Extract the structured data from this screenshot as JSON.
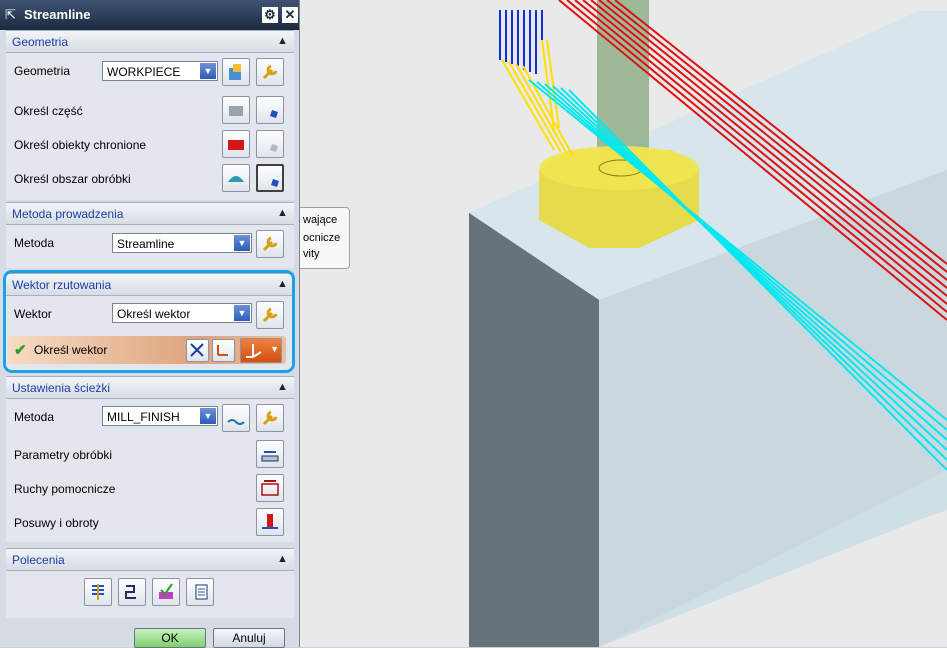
{
  "dialog": {
    "title": "Streamline",
    "settings_icon": "gear-icon",
    "close_icon": "close-icon"
  },
  "geometry": {
    "header": "Geometria",
    "geometry_label": "Geometria",
    "geometry_value": "WORKPIECE",
    "part_label": "Określ część",
    "protected_label": "Określ obiekty chronione",
    "machining_area_label": "Określ obszar obróbki"
  },
  "drive_method": {
    "header": "Metoda prowadzenia",
    "method_label": "Metoda",
    "method_value": "Streamline"
  },
  "projection_vector": {
    "header": "Wektor rzutowania",
    "vector_label": "Wektor",
    "vector_value": "Określ wektor",
    "specify_label": "Określ wektor"
  },
  "path_settings": {
    "header": "Ustawienia ścieżki",
    "method_label": "Metoda",
    "method_value": "MILL_FINISH",
    "cutting_params_label": "Parametry obróbki",
    "non_cutting_label": "Ruchy pomocnicze",
    "feeds_speeds_label": "Posuwy i obroty"
  },
  "commands": {
    "header": "Polecenia"
  },
  "buttons": {
    "ok": "OK",
    "cancel": "Anuluj"
  },
  "tooltip": {
    "line1": "wające",
    "line2": "ocnicze",
    "line3": "vity"
  },
  "colors": {
    "section_header_text": "#1a3ea8",
    "highlight_border": "#1ca0e8",
    "toolpath_red": "#e01010",
    "toolpath_cyan": "#00e8f0",
    "toolpath_yellow": "#ffe000",
    "toolpath_blue": "#1030d0"
  }
}
